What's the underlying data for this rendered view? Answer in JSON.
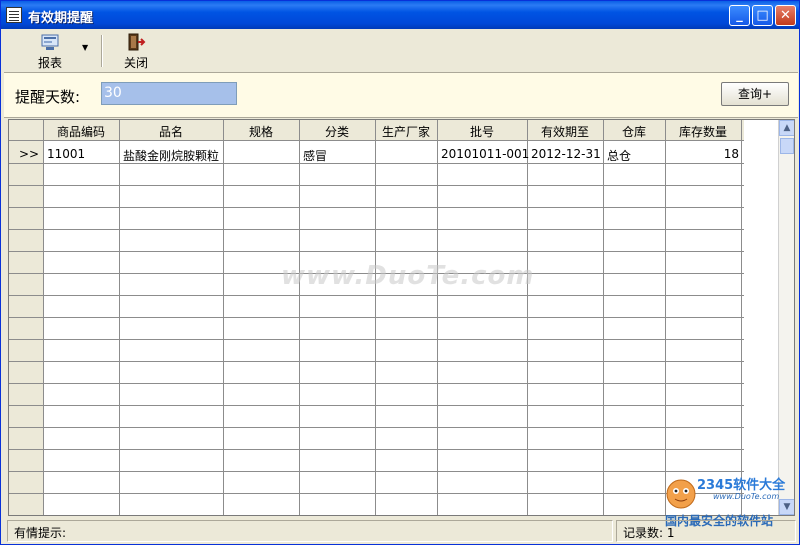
{
  "window": {
    "title": "有效期提醒"
  },
  "toolbar": {
    "report_label": "报表",
    "close_label": "关闭"
  },
  "filter": {
    "days_label": "提醒天数:",
    "days_value": "30",
    "query_label": "查询+"
  },
  "table": {
    "columns": [
      "商品编码",
      "品名",
      "规格",
      "分类",
      "生产厂家",
      "批号",
      "有效期至",
      "仓库",
      "库存数量"
    ],
    "row_marker": ">>",
    "rows": [
      [
        "11001",
        "盐酸金刚烷胺颗粒",
        "",
        "感冒",
        "",
        "20101011-001",
        "2012-12-31",
        "总仓",
        "18"
      ]
    ]
  },
  "watermark": "www.DuoTe.com",
  "status": {
    "hint_label": "有情提示:",
    "count_label": "记录数:",
    "count_value": "1"
  },
  "logo": {
    "brand": "2345软件大全",
    "url": "www.DuoTe.com",
    "slogan": "国内最安全的软件站"
  }
}
